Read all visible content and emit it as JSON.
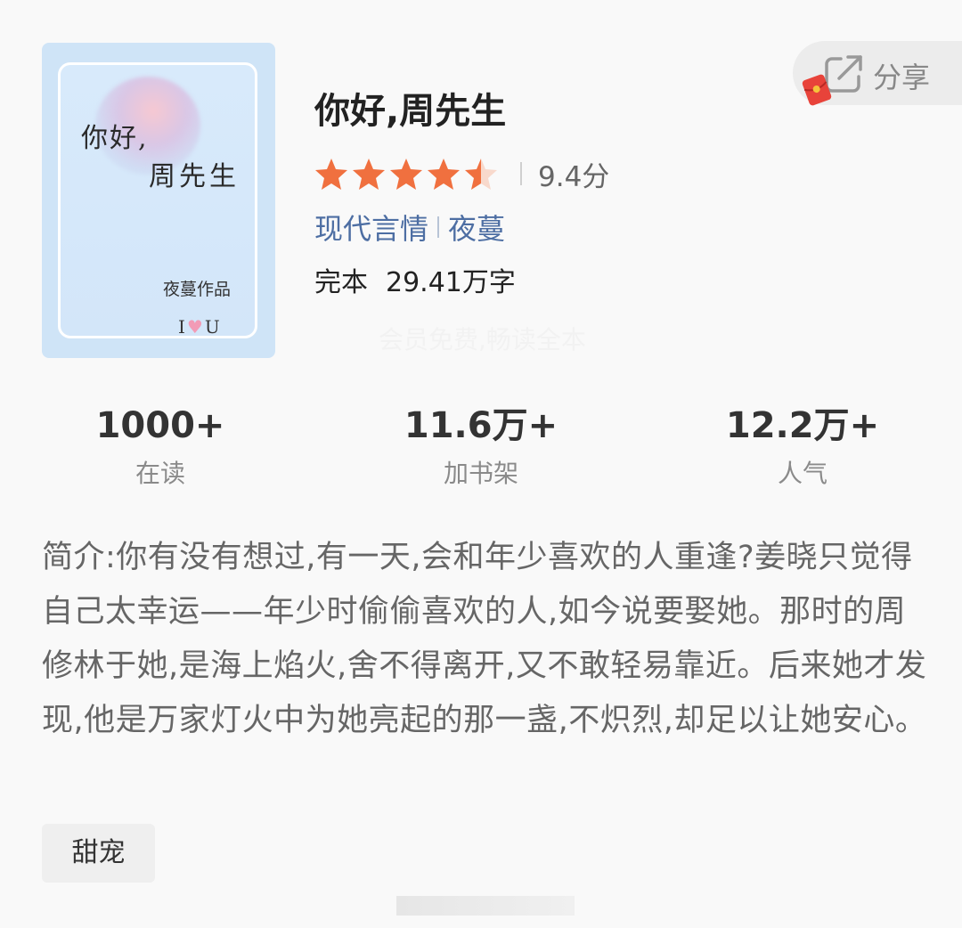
{
  "cover": {
    "title_line1": "你好,",
    "title_line2": "周先生",
    "author_line": "夜蔓作品",
    "iu_left": "I",
    "iu_heart": "♥",
    "iu_right": "U",
    "bg_color": "#cfe4f7"
  },
  "share": {
    "label": "分享",
    "icon": "share-icon"
  },
  "book": {
    "title": "你好,周先生",
    "rating_stars": 4.5,
    "score": "9.4分",
    "category": "现代言情",
    "author": "夜蔓",
    "status": "完本",
    "word_count": "29.41万字",
    "vip_watermark": "会员免费,畅读全本"
  },
  "stats": [
    {
      "value": "1000+",
      "label": "在读"
    },
    {
      "value": "11.6万+",
      "label": "加书架"
    },
    {
      "value": "12.2万+",
      "label": "人气"
    }
  ],
  "synopsis": "简介:你有没有想过,有一天,会和年少喜欢的人重逢?姜晓只觉得自己太幸运——年少时偷偷喜欢的人,如今说要娶她。那时的周修林于她,是海上焰火,舍不得离开,又不敢轻易靠近。后来她才发现,他是万家灯火中为她亮起的那一盏,不炽烈,却足以让她安心。",
  "genre_tag": "甜宠",
  "colors": {
    "star": "#f0703f",
    "link": "#4d6ea3"
  }
}
